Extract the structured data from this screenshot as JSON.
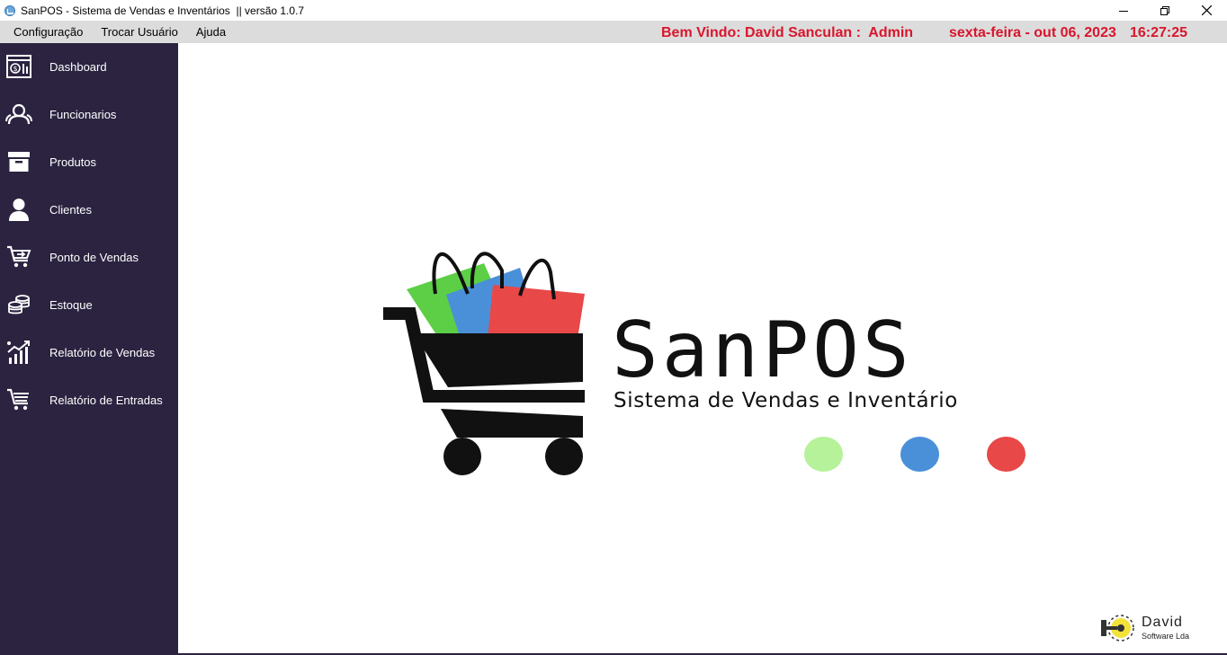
{
  "window": {
    "title": "SanPOS - Sistema de Vendas e Inventários  || versão 1.0.7",
    "controls": [
      "minimize-icon",
      "restore-icon",
      "close-icon"
    ]
  },
  "menubar": {
    "items": [
      "Configuração",
      "Trocar Usuário",
      "Ajuda"
    ],
    "welcome": "Bem Vindo: David Sanculan :  Admin",
    "date": "sexta-feira - out 06, 2023",
    "time": "16:27:25",
    "accent_color": "#d8162c"
  },
  "sidebar": {
    "background": "#2b2340",
    "items": [
      {
        "label": "Dashboard",
        "icon": "dashboard-icon"
      },
      {
        "label": "Funcionarios",
        "icon": "users-icon"
      },
      {
        "label": "Produtos",
        "icon": "box-icon"
      },
      {
        "label": "Clientes",
        "icon": "user-icon"
      },
      {
        "label": "Ponto de Vendas",
        "icon": "cart-icon"
      },
      {
        "label": "Estoque",
        "icon": "coins-stack-icon"
      },
      {
        "label": "Relatório de Vendas",
        "icon": "growth-chart-icon"
      },
      {
        "label": "Relatório de Entradas",
        "icon": "cart-report-icon"
      }
    ]
  },
  "main": {
    "brand_title": "SanPOS",
    "brand_subtitle": "Sistema de Vendas e Inventário",
    "dot_colors": [
      "#b6f29a",
      "#4a90d9",
      "#e84848"
    ],
    "bag_colors": [
      "#5ccf46",
      "#4a90d9",
      "#e84848"
    ]
  },
  "footer": {
    "name": "David",
    "subtitle": "Software Lda"
  }
}
